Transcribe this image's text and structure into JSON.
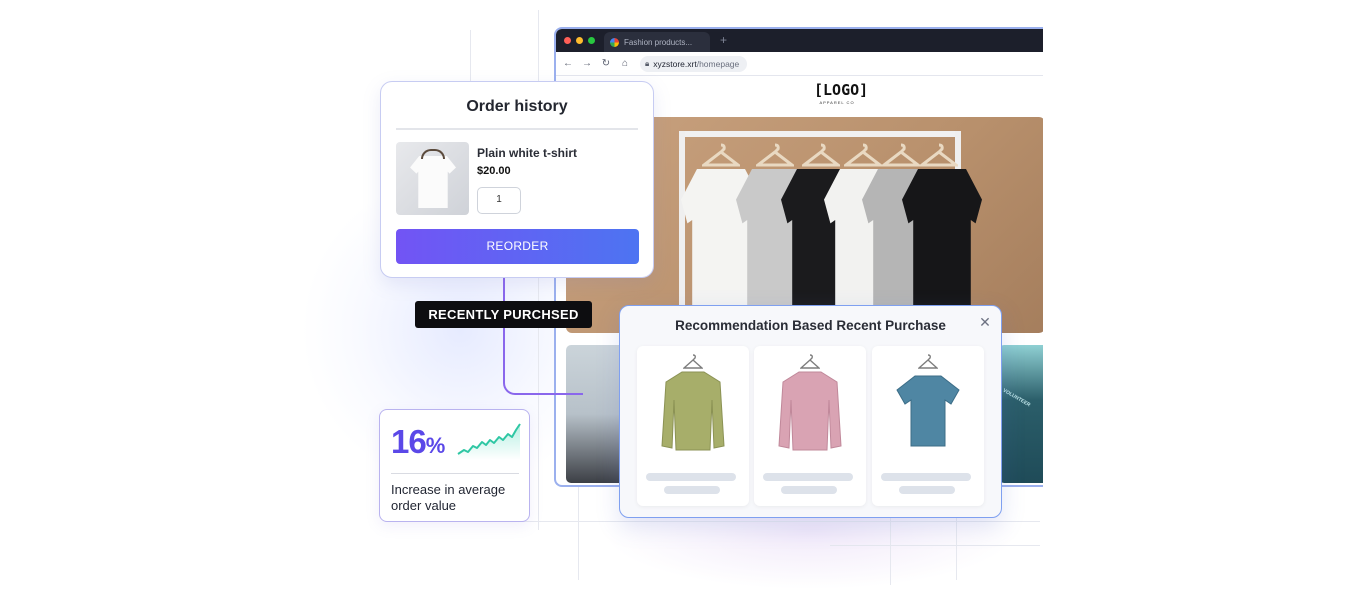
{
  "browser": {
    "tab_title": "Fashion products...",
    "url_host": "xyzstore.xrt",
    "url_path": "/homepage",
    "logo_text": "LOGO",
    "logo_sub": "APPAREL CO"
  },
  "order_history": {
    "title": "Order history",
    "product_name": "Plain white t-shirt",
    "price": "$20.00",
    "quantity": "1",
    "reorder_label": "REORDER"
  },
  "recent_badge": "RECENTLY PURCHSED",
  "stat": {
    "value": "16",
    "unit": "%",
    "label": "Increase in average order value"
  },
  "recommendation": {
    "title": "Recommendation Based Recent Purchase",
    "close_symbol": "✕",
    "items": [
      {
        "name": "olive-sweatshirt",
        "color": "#a7ae6a"
      },
      {
        "name": "pink-sweatshirt",
        "color": "#d9a3b3"
      },
      {
        "name": "teal-tshirt",
        "color": "#4f86a3"
      }
    ]
  },
  "side_product_text": "VOLUNTEER",
  "colors": {
    "accent_purple": "#5b48e8",
    "button_gradient_start": "#7254f4",
    "button_gradient_end": "#4d74f2",
    "badge_bg": "#0d0d10"
  }
}
